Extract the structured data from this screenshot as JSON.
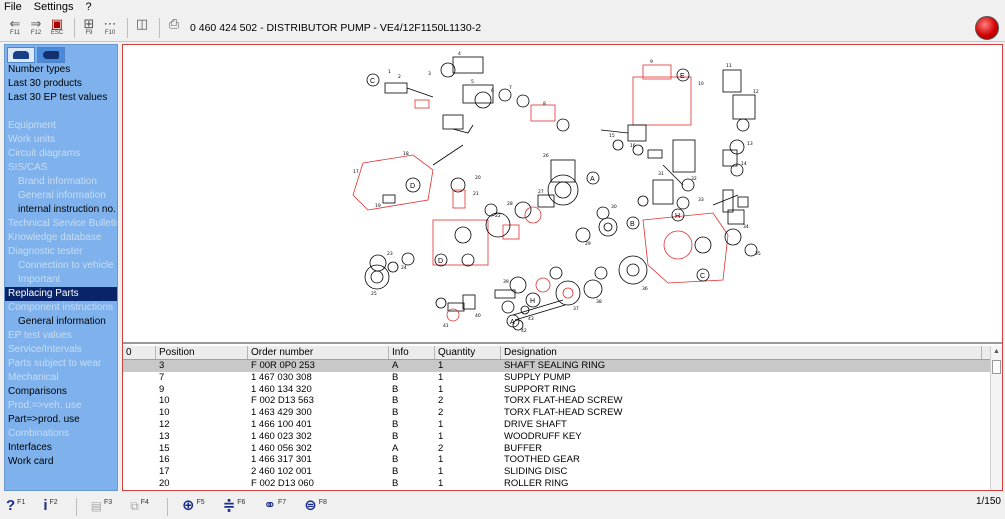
{
  "menu": [
    "File",
    "Settings",
    "?"
  ],
  "toolbar": {
    "buttons": [
      {
        "glyph": "⇐",
        "key": "F11"
      },
      {
        "glyph": "⇒",
        "key": "F12"
      },
      {
        "glyph": "▣",
        "key": "ESC"
      },
      {
        "glyph": "⊞",
        "key": "F9"
      },
      {
        "glyph": "⋯",
        "key": "F10"
      }
    ],
    "title": "0 460 424 502 - DISTRIBUTOR PUMP - VE4/12F1150L1130-2"
  },
  "sidebar": {
    "items": [
      {
        "label": "Number types",
        "state": "on"
      },
      {
        "label": "Last 30 products",
        "state": "on"
      },
      {
        "label": "Last 30 EP test values",
        "state": "on"
      },
      {
        "label": "",
        "state": "gap"
      },
      {
        "label": "Equipment",
        "state": "off"
      },
      {
        "label": "Work units",
        "state": "off"
      },
      {
        "label": "Circuit diagrams",
        "state": "off"
      },
      {
        "label": "SIS/CAS",
        "state": "off"
      },
      {
        "label": "Brand information",
        "state": "off",
        "sub": true
      },
      {
        "label": "General information",
        "state": "off",
        "sub": true
      },
      {
        "label": "internal instruction no.",
        "state": "on",
        "sub": true
      },
      {
        "label": "Technical Service Bulletins",
        "state": "off"
      },
      {
        "label": "Knowledge database",
        "state": "off"
      },
      {
        "label": "Diagnostic tester",
        "state": "off"
      },
      {
        "label": "Connection to vehicle",
        "state": "off",
        "sub": true
      },
      {
        "label": "Important",
        "state": "off",
        "sub": true
      },
      {
        "label": "Replacing Parts",
        "state": "sel"
      },
      {
        "label": "Component instructions",
        "state": "off"
      },
      {
        "label": "General information",
        "state": "on",
        "sub": true
      },
      {
        "label": "EP test values",
        "state": "off"
      },
      {
        "label": "Service/Intervals",
        "state": "off"
      },
      {
        "label": "Parts subject to wear",
        "state": "off"
      },
      {
        "label": "Mechanical",
        "state": "off"
      },
      {
        "label": "Comparisons",
        "state": "on"
      },
      {
        "label": "Prod.=>veh. use",
        "state": "off"
      },
      {
        "label": "Part=>prod. use",
        "state": "on"
      },
      {
        "label": "Combinations",
        "state": "off"
      },
      {
        "label": "Interfaces",
        "state": "on"
      },
      {
        "label": "Work card",
        "state": "on"
      }
    ]
  },
  "table": {
    "headers": [
      "0",
      "Position",
      "Order number",
      "Info",
      "Quantity",
      "Designation"
    ],
    "rows": [
      [
        "",
        "3",
        "F 00R 0P0 253",
        "A",
        "1",
        "SHAFT SEALING RING"
      ],
      [
        "",
        "7",
        "1 467 030 308",
        "B",
        "1",
        "SUPPLY PUMP"
      ],
      [
        "",
        "9",
        "1 460 134 320",
        "B",
        "1",
        "SUPPORT RING"
      ],
      [
        "",
        "10",
        "F 002 D13 563",
        "B",
        "2",
        "TORX FLAT-HEAD SCREW"
      ],
      [
        "",
        "10",
        "1 463 429 300",
        "B",
        "2",
        "TORX FLAT-HEAD SCREW"
      ],
      [
        "",
        "12",
        "1 466 100 401",
        "B",
        "1",
        "DRIVE SHAFT"
      ],
      [
        "",
        "13",
        "1 460 023 302",
        "B",
        "1",
        "WOODRUFF KEY"
      ],
      [
        "",
        "15",
        "1 460 056 302",
        "A",
        "2",
        "BUFFER"
      ],
      [
        "",
        "16",
        "1 466 317 301",
        "B",
        "1",
        "TOOTHED GEAR"
      ],
      [
        "",
        "17",
        "2 460 102 001",
        "B",
        "1",
        "SLIDING DISC"
      ],
      [
        "",
        "20",
        "F 002 D13 060",
        "B",
        "1",
        "ROLLER RING"
      ]
    ]
  },
  "statusbar": {
    "buttons": [
      {
        "glyph": "?",
        "key": "F1"
      },
      {
        "glyph": "i",
        "key": "F2"
      },
      {
        "glyph": "▤",
        "key": "F3",
        "dim": true
      },
      {
        "glyph": "⧉",
        "key": "F4",
        "dim": true
      },
      {
        "glyph": "⊕",
        "key": "F5"
      },
      {
        "glyph": "≑",
        "key": "F6"
      },
      {
        "glyph": "⚭",
        "key": "F7"
      },
      {
        "glyph": "⊜",
        "key": "F8"
      }
    ],
    "page_counter": "1/150"
  },
  "colors": {
    "sidebar_bg": "#7fb2ec",
    "selected_item": "#0a246a",
    "content_border": "#d04040",
    "drawing_highlight": "#e03030"
  }
}
